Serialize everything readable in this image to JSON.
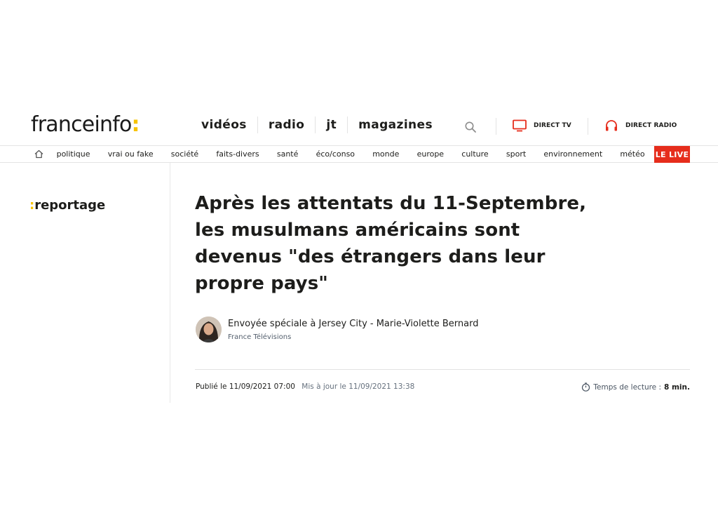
{
  "header": {
    "logo_text": "franceinfo",
    "logo_colon": ":",
    "nav": [
      "vidéos",
      "radio",
      "jt",
      "magazines"
    ],
    "direct_tv": "DIRECT TV",
    "direct_radio": "DIRECT RADIO"
  },
  "categories": [
    "politique",
    "vrai ou fake",
    "société",
    "faits-divers",
    "santé",
    "éco/conso",
    "monde",
    "europe",
    "culture",
    "sport",
    "environnement",
    "météo"
  ],
  "live_label": "LE LIVE",
  "article": {
    "rubric_colon": ":",
    "rubric": "reportage",
    "title": "Après les attentats du 11-Septembre, les musulmans américains sont devenus \"des étrangers dans leur propre pays\"",
    "author": "Envoyée spéciale à Jersey City - Marie-Violette Bernard",
    "organization": "France Télévisions",
    "published": "Publié le 11/09/2021 07:00",
    "updated": "Mis à jour le 11/09/2021 13:38",
    "reading_label": "Temps de lecture :",
    "reading_time": "8 min."
  },
  "colors": {
    "accent_yellow": "#f7c300",
    "live_red": "#e62d1c",
    "direct_red": "#e62d1c"
  },
  "icons": [
    "home-icon",
    "search-icon",
    "tv-icon",
    "headphones-icon",
    "stopwatch-icon"
  ]
}
